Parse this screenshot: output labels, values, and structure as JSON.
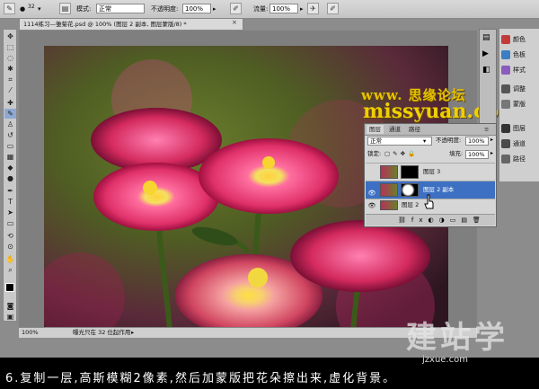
{
  "options_bar": {
    "brush_size": "32",
    "mode_label": "模式:",
    "mode_value": "正常",
    "opacity_label": "不透明度:",
    "opacity_value": "100%",
    "flow_label": "流量:",
    "flow_value": "100%"
  },
  "document": {
    "tab_title": "1114练习—雏菊花.psd @ 100% (图层 2 副本, 图层蒙版/8) *",
    "zoom": "100%",
    "status_text": "曝光只在 32 位起作用"
  },
  "panels": {
    "items": [
      {
        "label": "颜色",
        "icon": "color-icon",
        "color": "#c23b3b"
      },
      {
        "label": "色板",
        "icon": "swatches-icon",
        "color": "#3b7ec2"
      },
      {
        "label": "样式",
        "icon": "styles-icon",
        "color": "#8b5bbd"
      },
      {
        "label": "调整",
        "icon": "adjustments-icon",
        "color": "#555555"
      },
      {
        "label": "蒙版",
        "icon": "masks-icon",
        "color": "#777777"
      },
      {
        "label": "图层",
        "icon": "layers-icon",
        "color": "#333333"
      },
      {
        "label": "通道",
        "icon": "channels-icon",
        "color": "#4a4a4a"
      },
      {
        "label": "路径",
        "icon": "paths-icon",
        "color": "#666666"
      }
    ]
  },
  "layers_panel": {
    "tabs": [
      "图层",
      "通道",
      "路径"
    ],
    "blend_mode": "正常",
    "opacity_label": "不透明度:",
    "opacity_value": "100%",
    "lock_label": "锁定:",
    "fill_label": "填充:",
    "fill_value": "100%",
    "layers": [
      {
        "name": "图层 3",
        "visible": false,
        "selected": false
      },
      {
        "name": "图层 2 副本",
        "visible": true,
        "selected": true
      },
      {
        "name": "图层 2",
        "visible": true,
        "selected": false
      }
    ]
  },
  "watermark": {
    "line1": "www. 思缘论坛",
    "line2": "missyuan.com"
  },
  "caption": "6.复制一层,高斯模糊2像素,然后加蒙版把花朵擦出来,虚化背景。",
  "logo": {
    "text": "建站学",
    "url": "jzxue.com"
  }
}
